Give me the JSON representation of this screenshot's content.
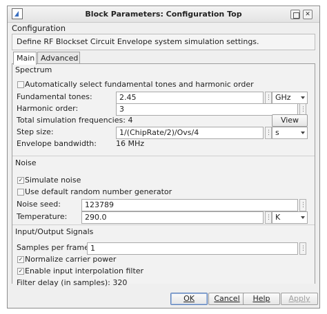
{
  "window": {
    "title": "Block Parameters: Configuration Top"
  },
  "config": {
    "group_title": "Configuration",
    "description": "Define RF Blockset Circuit Envelope system simulation settings."
  },
  "tabs": [
    {
      "label": "Main",
      "active": true
    },
    {
      "label": "Advanced",
      "active": false
    }
  ],
  "spectrum": {
    "header": "Spectrum",
    "auto_select_label": "Automatically select fundamental tones and harmonic order",
    "auto_select_checked": false,
    "fund_tones_label": "Fundamental tones:",
    "fund_tones_value": "2.45",
    "fund_tones_unit": "GHz",
    "harmonic_label": "Harmonic order:",
    "harmonic_value": "3",
    "total_freq_text": "Total simulation frequencies: 4",
    "view_button": "View",
    "step_label": "Step size:",
    "step_value": "1/(ChipRate/2)/Ovs/4",
    "step_unit": "s",
    "env_bw_label": "Envelope bandwidth:",
    "env_bw_value": "16 MHz"
  },
  "noise": {
    "header": "Noise",
    "simulate_label": "Simulate noise",
    "simulate_checked": true,
    "default_rng_label": "Use default random number generator",
    "default_rng_checked": false,
    "seed_label": "Noise seed:",
    "seed_value": "123789",
    "temp_label": "Temperature:",
    "temp_value": "290.0",
    "temp_unit": "K"
  },
  "io": {
    "header": "Input/Output Signals",
    "samples_label": "Samples per frame:",
    "samples_value": "1",
    "normalize_label": "Normalize carrier power",
    "normalize_checked": true,
    "interp_label": "Enable input interpolation filter",
    "interp_checked": true,
    "filter_delay_text": "Filter delay (in samples): 320"
  },
  "buttons": {
    "ok": "OK",
    "cancel": "Cancel",
    "help": "Help",
    "apply": "Apply"
  },
  "icons": {
    "window_icon": "simulink-block-icon",
    "minimize": "minimize-icon",
    "close": "close-icon",
    "checkmark": "✓"
  }
}
